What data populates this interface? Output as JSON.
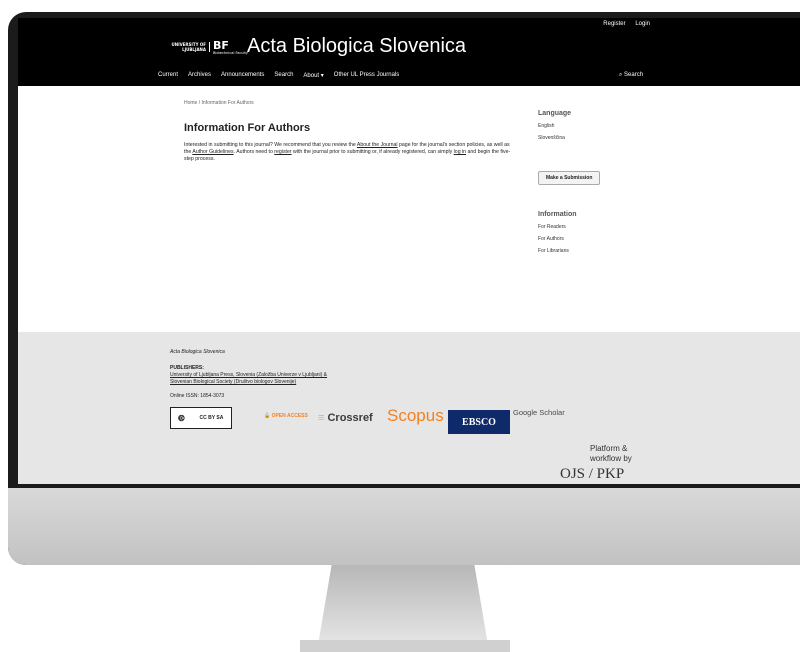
{
  "header": {
    "user_nav": [
      "Register",
      "Login"
    ],
    "logo": {
      "bf": "BF",
      "university": "UNIVERSITY OF LJUBLJANA",
      "faculty": "Biotechnical Faculty"
    },
    "site_title": "Acta Biologica Slovenica",
    "nav_items": [
      "Current",
      "Archives",
      "Announcements",
      "Search",
      "About ▾",
      "Other UL Press Journals"
    ],
    "search_label": "Search"
  },
  "main": {
    "breadcrumb": "Home  /  Information For Authors",
    "title": "Information For Authors",
    "intro": {
      "p1": "Interested in submitting to this journal? We recommend that you review the ",
      "link1": "About the Journal",
      "p2": " page for the journal's section policies, as well as the ",
      "link2": "Author Guidelines",
      "p3": ". Authors need to ",
      "link3": "register",
      "p4": " with the journal prior to submitting or, if already registered, can simply ",
      "link4": "log in",
      "p5": " and begin the five-step process."
    }
  },
  "sidebar": {
    "language_heading": "Language",
    "languages": [
      "English",
      "Slovenščina"
    ],
    "submit_label": "Make a Submission",
    "info_heading": "Information",
    "info_links": [
      "For Readers",
      "For Authors",
      "For Librarians"
    ]
  },
  "footer": {
    "journal": "Acta Biologica Slovenica",
    "publishers_heading": "PUBLISHERS:",
    "publisher1": "University of Ljubljana Press, Slovenia (Založba Univerze v Ljubljani) &",
    "publisher2": "Slovenian Biological Society (Društvo biologov Slovenije)",
    "issn": "Online ISSN: 1854-3073",
    "cc": "CC BY SA",
    "open_access": "OPEN ACCESS",
    "crossref": "Crossref",
    "scopus": "Scopus",
    "ebsco": "EBSCO",
    "gscholar": "Google Scholar",
    "platform_line1": "Platform &",
    "platform_line2": "workflow by",
    "ojs": "OJS / PKP"
  }
}
